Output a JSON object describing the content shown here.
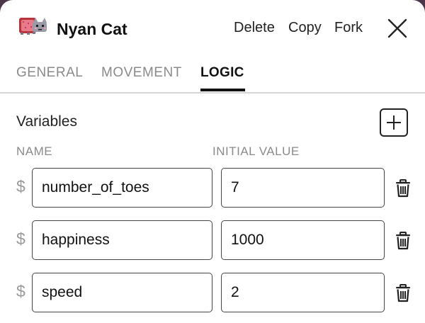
{
  "header": {
    "title": "Nyan Cat",
    "sprite_icon": "nyan-cat-sprite",
    "actions": {
      "delete_label": "Delete",
      "copy_label": "Copy",
      "fork_label": "Fork"
    },
    "close_icon": "close-x-icon"
  },
  "tabs": {
    "general": "GENERAL",
    "movement": "MOVEMENT",
    "logic": "LOGIC",
    "active": "LOGIC"
  },
  "variables": {
    "section_title": "Variables",
    "add_icon": "plus-icon",
    "columns": {
      "name": "NAME",
      "initial_value": "INITIAL VALUE"
    },
    "prefix_symbol": "$",
    "rows": [
      {
        "name": "number_of_toes",
        "initial_value": "7"
      },
      {
        "name": "happiness",
        "initial_value": "1000"
      },
      {
        "name": "speed",
        "initial_value": "2"
      }
    ],
    "delete_icon": "trash-icon"
  },
  "colors": {
    "frame_top": "#4a3648",
    "active_tab": "#111111",
    "inactive_tab": "#8a8a8a",
    "divider": "#d6d6d6"
  }
}
